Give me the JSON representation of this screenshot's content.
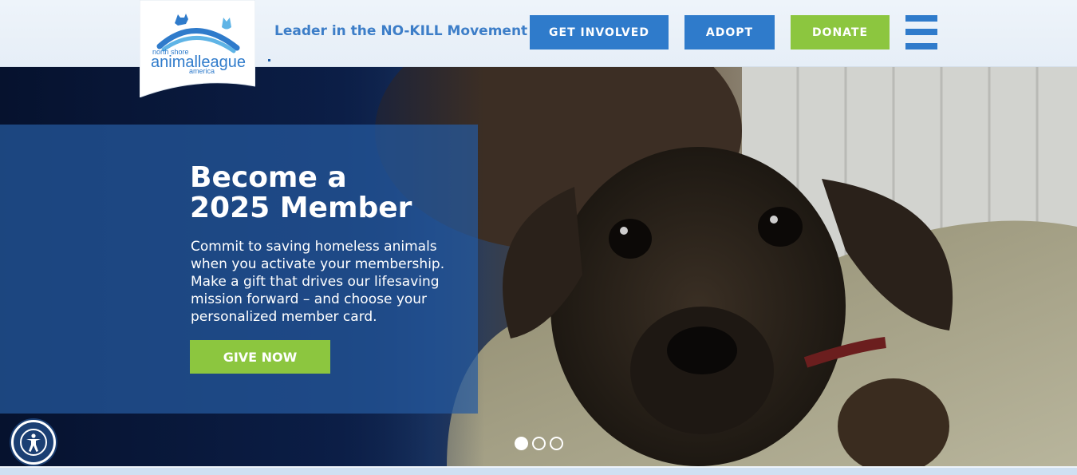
{
  "header": {
    "tagline": "Leader in the NO-KILL Movement",
    "nav": {
      "get_involved": "GET INVOLVED",
      "adopt": "ADOPT",
      "donate": "DONATE"
    },
    "menu_icon": "hamburger-menu-icon"
  },
  "logo": {
    "line1": "north shore",
    "line2": "animalleague",
    "line3": "america"
  },
  "hero": {
    "title_line1": "Become a",
    "title_line2": "2025 Member",
    "body": "Commit to saving homeless animals when you activate your membership. Make a gift that drives our lifesaving mission forward – and choose your personalized member card.",
    "cta": "GIVE NOW",
    "carousel": {
      "slides": 3,
      "active_index": 0
    }
  },
  "accessibility": {
    "icon": "accessibility-icon"
  },
  "colors": {
    "brand_blue": "#2f7bcb",
    "tagline_blue": "#3d7ec8",
    "donate_green": "#8cc63f",
    "hero_navy": "#0b1d45"
  }
}
